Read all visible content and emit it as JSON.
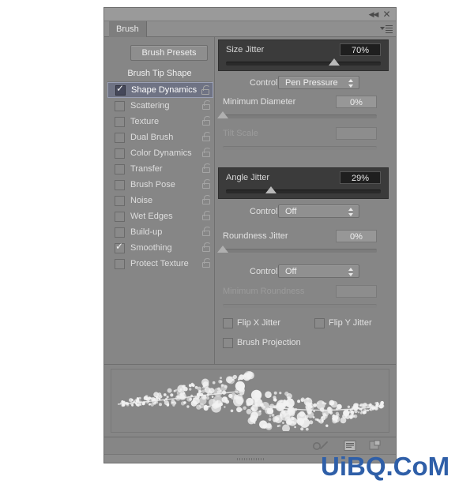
{
  "window": {
    "title_tab": "Brush",
    "collapse_icon": "double-left-chevron-icon",
    "close_icon": "close-icon",
    "menu_icon": "panel-menu-icon"
  },
  "sidebar": {
    "presets_button": "Brush Presets",
    "tip_shape": "Brush Tip Shape",
    "items": [
      {
        "label": "Shape Dynamics",
        "checked": true,
        "selected": true,
        "locked": false
      },
      {
        "label": "Scattering",
        "checked": false,
        "selected": false,
        "locked": false
      },
      {
        "label": "Texture",
        "checked": false,
        "selected": false,
        "locked": false
      },
      {
        "label": "Dual Brush",
        "checked": false,
        "selected": false,
        "locked": false
      },
      {
        "label": "Color Dynamics",
        "checked": false,
        "selected": false,
        "locked": false
      },
      {
        "label": "Transfer",
        "checked": false,
        "selected": false,
        "locked": false
      },
      {
        "label": "Brush Pose",
        "checked": false,
        "selected": false,
        "locked": false
      },
      {
        "label": "Noise",
        "checked": false,
        "selected": false,
        "locked": false
      },
      {
        "label": "Wet Edges",
        "checked": false,
        "selected": false,
        "locked": false
      },
      {
        "label": "Build-up",
        "checked": false,
        "selected": false,
        "locked": false
      },
      {
        "label": "Smoothing",
        "checked": true,
        "selected": false,
        "locked": false
      },
      {
        "label": "Protect Texture",
        "checked": false,
        "selected": false,
        "locked": false
      }
    ]
  },
  "shape_dynamics": {
    "size_jitter": {
      "label": "Size Jitter",
      "value": "70%",
      "percent": 70,
      "highlighted": true
    },
    "size_control": {
      "label": "Control:",
      "value": "Pen Pressure"
    },
    "minimum_diameter": {
      "label": "Minimum Diameter",
      "value": "0%",
      "percent": 0
    },
    "tilt_scale": {
      "label": "Tilt Scale",
      "value": "",
      "percent": 0,
      "disabled": true
    },
    "angle_jitter": {
      "label": "Angle Jitter",
      "value": "29%",
      "percent": 29,
      "highlighted": true
    },
    "angle_control": {
      "label": "Control:",
      "value": "Off"
    },
    "roundness_jitter": {
      "label": "Roundness Jitter",
      "value": "0%",
      "percent": 0
    },
    "roundness_control": {
      "label": "Control:",
      "value": "Off"
    },
    "minimum_roundness": {
      "label": "Minimum Roundness",
      "value": "",
      "percent": 0,
      "disabled": true
    },
    "flip_x": {
      "label": "Flip X Jitter",
      "checked": false
    },
    "flip_y": {
      "label": "Flip Y Jitter",
      "checked": false
    },
    "brush_projection": {
      "label": "Brush Projection",
      "checked": false
    }
  },
  "footer": {
    "toggle_icon": "brush-toggle-icon",
    "new_preset_icon": "new-brush-preset-icon",
    "delete_icon": "delete-brush-icon",
    "resize_grip": "resize-grip"
  },
  "watermark": {
    "text": "UiBQ.CoM"
  },
  "colors": {
    "panel_bg": "#868686",
    "highlight_block": "#3b3b3b",
    "selected_row": "#6f7384",
    "text": "#e2e2e2",
    "watermark": "#2f5fa8"
  }
}
